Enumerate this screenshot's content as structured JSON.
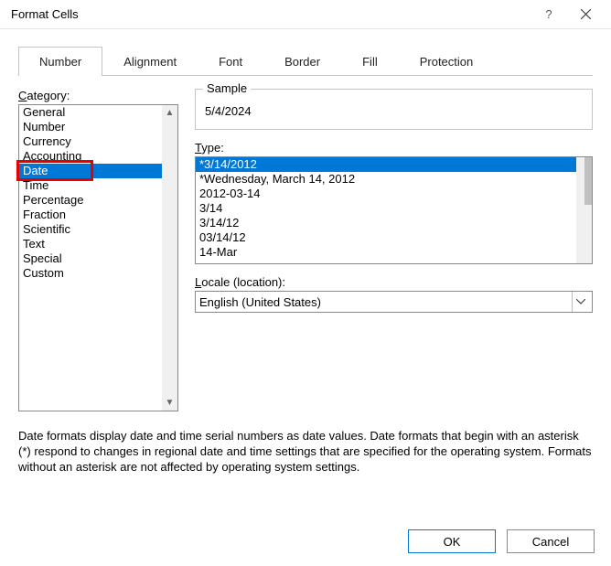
{
  "title": "Format Cells",
  "tabs": [
    "Number",
    "Alignment",
    "Font",
    "Border",
    "Fill",
    "Protection"
  ],
  "active_tab": 0,
  "category": {
    "label_pre": "",
    "label_key": "C",
    "label_post": "ategory:",
    "items": [
      "General",
      "Number",
      "Currency",
      "Accounting",
      "Date",
      "Time",
      "Percentage",
      "Fraction",
      "Scientific",
      "Text",
      "Special",
      "Custom"
    ],
    "selected_index": 4
  },
  "sample": {
    "legend": "Sample",
    "value": "5/4/2024"
  },
  "type": {
    "label_key": "T",
    "label_post": "ype:",
    "items": [
      "*3/14/2012",
      "*Wednesday, March 14, 2012",
      "2012-03-14",
      "3/14",
      "3/14/12",
      "03/14/12",
      "14-Mar"
    ],
    "selected_index": 0
  },
  "locale": {
    "label_pre": "",
    "label_key": "L",
    "label_post": "ocale (location):",
    "value": "English (United States)"
  },
  "description": "Date formats display date and time serial numbers as date values.  Date formats that begin with an asterisk (*) respond to changes in regional date and time settings that are specified for the operating system. Formats without an asterisk are not affected by operating system settings.",
  "buttons": {
    "ok": "OK",
    "cancel": "Cancel"
  }
}
